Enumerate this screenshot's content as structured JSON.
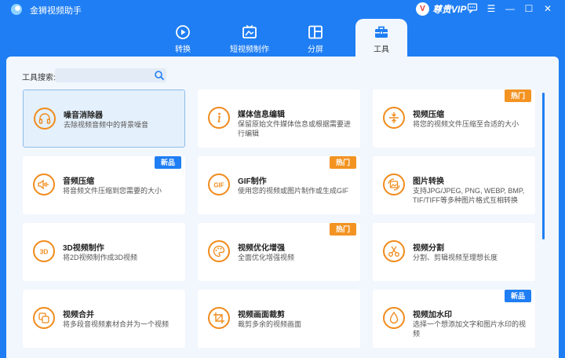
{
  "app": {
    "title": "金狮视频助手",
    "vip_label": "尊贵VIP",
    "vip_badge_char": "V"
  },
  "window_controls": {
    "menu": "☰",
    "minimize": "—",
    "maximize": "☐",
    "close": "✕"
  },
  "tabs": [
    {
      "label": "转换",
      "icon": "convert-icon",
      "active": false
    },
    {
      "label": "短视频制作",
      "icon": "short-video-icon",
      "active": false
    },
    {
      "label": "分屏",
      "icon": "split-screen-icon",
      "active": false
    },
    {
      "label": "工具",
      "icon": "toolbox-icon",
      "active": true
    }
  ],
  "search": {
    "label": "工具搜索:",
    "value": "",
    "placeholder": ""
  },
  "tools": [
    {
      "title": "噪音消除器",
      "desc": "去除视频音频中的背景噪音",
      "icon": "headphones-icon",
      "badge": ""
    },
    {
      "title": "媒体信息编辑",
      "desc": "保留原始文件媒体信息或根据需要进行编辑",
      "icon": "info-icon",
      "badge": ""
    },
    {
      "title": "视频压缩",
      "desc": "将您的视频文件压缩至合适的大小",
      "icon": "compress-icon",
      "badge": "热门"
    },
    {
      "title": "音频压缩",
      "desc": "将音频文件压缩到您需要的大小",
      "icon": "audio-compress-icon",
      "badge": "新品"
    },
    {
      "title": "GIF制作",
      "desc": "使用您的视频或图片制作或生成GIF",
      "icon": "gif-icon",
      "badge": "热门"
    },
    {
      "title": "图片转换",
      "desc": "支持JPG/JPEG, PNG, WEBP, BMP, TIF/TIFF等多种图片格式互相转换",
      "icon": "image-convert-icon",
      "badge": ""
    },
    {
      "title": "3D视频制作",
      "desc": "将2D视频制作成3D视频",
      "icon": "3d-icon",
      "badge": ""
    },
    {
      "title": "视频优化增强",
      "desc": "全面优化增强视频",
      "icon": "palette-icon",
      "badge": "热门"
    },
    {
      "title": "视频分割",
      "desc": "分割、剪辑视频至理想长度",
      "icon": "scissors-icon",
      "badge": ""
    },
    {
      "title": "视频合并",
      "desc": "将多段音视频素材合并为一个视频",
      "icon": "merge-icon",
      "badge": ""
    },
    {
      "title": "视频画面裁剪",
      "desc": "裁剪多余的视频画面",
      "icon": "crop-icon",
      "badge": ""
    },
    {
      "title": "视频加水印",
      "desc": "选择一个想添加文字和图片水印的视频",
      "icon": "watermark-icon",
      "badge": "新品"
    }
  ],
  "colors": {
    "brand": "#1f7ef3",
    "accent": "#f08b1c",
    "hot_badge": "#f39322",
    "new_badge": "#1f7ef3",
    "background": "#f2f7fd"
  }
}
